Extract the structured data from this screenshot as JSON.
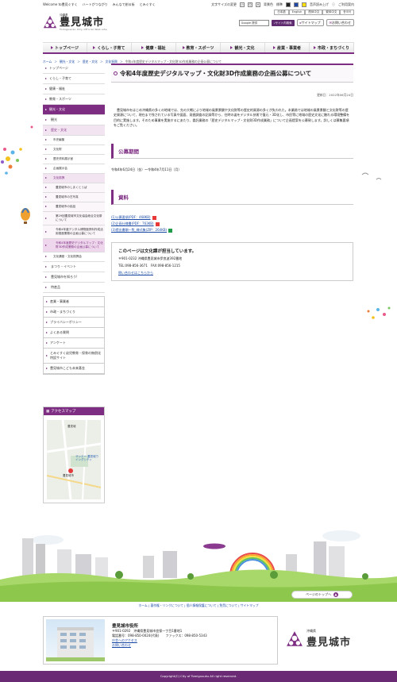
{
  "util": {
    "left_links": [
      "Welcome to豊見ぐすく",
      "ハートがつながり",
      "みんなで創る街",
      "とみぐすく"
    ],
    "font_size_label": "文字サイズの変更",
    "font_sizes": [
      "小",
      "中",
      "大"
    ],
    "color_label": "背景色",
    "color_default": "標準",
    "reader": "音声読み上げ",
    "usage": "ご利用案内"
  },
  "header": {
    "logo_small": "沖縄県",
    "logo_name": "豊見城市",
    "logo_en": "Tomigusuku City Official Web site",
    "langs": [
      "日本語",
      "English",
      "簡体中文",
      "繁体中文",
      "한국어"
    ],
    "search_placeholder": "Google 提供",
    "search_button": "サイト内検索",
    "sitemap": "サイトマップ",
    "contact": "お問い合わせ"
  },
  "gnav": [
    "トップページ",
    "くらし・子育て",
    "健康・福祉",
    "教育・スポーツ",
    "観光・文化",
    "産業・事業者",
    "市政・まちづくり"
  ],
  "breadcrumb": [
    "ホーム",
    "観光・文化",
    "歴史・文化",
    "文化振興",
    "令和4年度歴史デジタルマップ・文化財3D作成業務の企画公募について"
  ],
  "sidebar": {
    "top": [
      "トップページ",
      "くらし・子育て",
      "健康・福祉",
      "教育・スポーツ"
    ],
    "active": "観光・文化",
    "kanko": "観光",
    "rekishi": "歴史・文化",
    "rekishi_items": [
      "市史編集",
      "文化財",
      "歴史資料展示室",
      "企画展示会"
    ],
    "bunka": "文化振興",
    "bunka_items": [
      "豊見城市のしまくとぅば",
      "豊見城市の古写真",
      "豊見城市の民話",
      "第29回豊見城市文化協会総合文化祭について",
      "令和4年度デジタル博物館資料作成活用推進業務の企画公募について",
      "令和4年度歴史デジタルマップ・文化財3D作成業務の企画公募について"
    ],
    "more": [
      "文化講座・文化振興会"
    ],
    "after": [
      "まつり・イベント",
      "豊見城市を知ろう!",
      "特産品"
    ],
    "box": [
      "産業・事業者",
      "市政・まちづくり",
      "プライバシーポリシー",
      "よくある質問",
      "アンケート",
      "とみぐすく幼児教育・保育の無償化特設サイト",
      "豊見城市こども未来基金"
    ],
    "access": "アクセスマップ",
    "map_labels": [
      "豊見城",
      "サンエー 豊見城ウイングシティ",
      "豊見城市"
    ]
  },
  "main": {
    "title": "令和4年度歴史デジタルマップ・文化財3D作成業務の企画公募について",
    "updated": "更新日：2022年06月24日",
    "body": "豊見城市をはじめ沖縄県の多くの地域では、先の大戦により地域の風景景観や文化財等の歴史的資源の多くが失われた。本業務では地域の風景景観と文化財等の歴史資源について、現在まで残されている写真や図面、発掘調査の記録等から、往時の姿をデジタル技術で復元・3D化し、市民等に地域の歴史文化に触れる環境整備を目的に実施します。そのため事業を実施するにあたり、委託業務の「歴史デジタルマップ・文化財3D作成業務」について企画提案を公募致します。詳しくは募集要項をご覧ください。",
    "period_heading": "公募期間",
    "period": "令和4年6月24日（金）～令和4年7月11日（月）",
    "files_heading": "資料",
    "files": [
      {
        "label": "(1)公募要項(PDF：468KB)",
        "type": "pdf"
      },
      {
        "label": "(2)企画仕様書(PDF：763KB)",
        "type": "pdf"
      },
      {
        "label": "(3)提出書類一覧_様式集(ZIP：264KB)",
        "type": "xls"
      }
    ],
    "contact_head": "このページは文化課が担当しています。",
    "contact_addr": "〒901-0232 沖縄県豊見城市伊良波392番地",
    "contact_tel": "TEL:098-856-3671　FAX:098-856-1215",
    "contact_link": "問い合わせはこちらから"
  },
  "to_top": "ページのトップへ",
  "footer_links": "ホーム | 著作権・リンクについて | 個人情報保護について | 免責について | サイトマップ",
  "footer": {
    "name": "豊見城市役所",
    "addr": "〒901-0292　沖縄県豊見城市宜保一丁目1番地1",
    "tel": "電話番号：098-850-0024(代表)　　ファックス：098-850-5343",
    "links": [
      "庁舎へのアクセス",
      "お問い合わせ"
    ]
  },
  "footer_logo": {
    "small": "沖縄県",
    "name": "豊見城市"
  },
  "copyright": "Copyright(C) City of Tomigusuku All right reserved.",
  "colors": {
    "accent": "#7d2d82",
    "link": "#1a4aa6"
  }
}
